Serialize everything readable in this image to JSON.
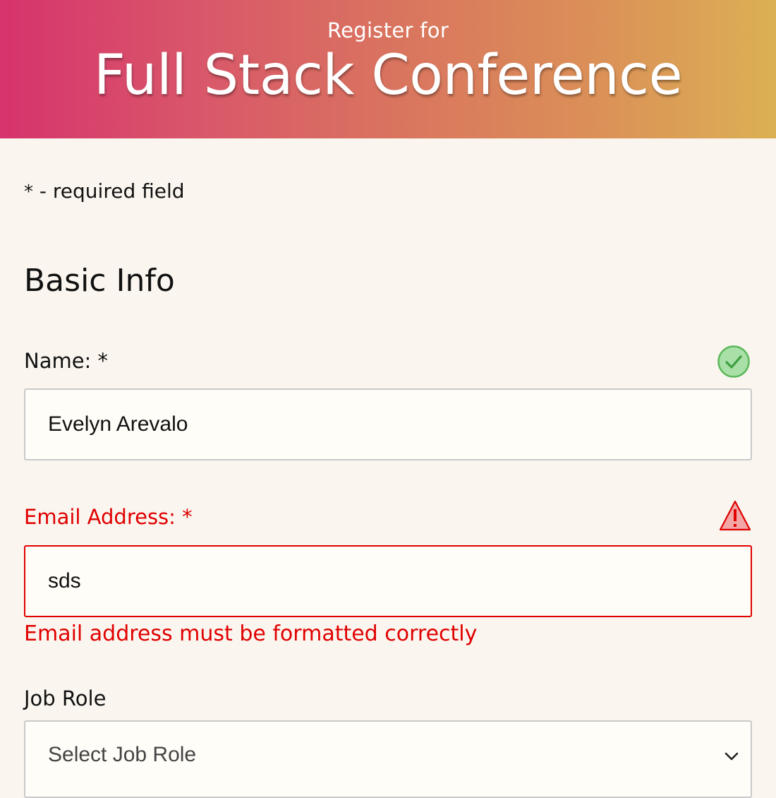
{
  "header": {
    "subtitle": "Register for",
    "title": "Full Stack Conference"
  },
  "required_note": {
    "asterisk": "*",
    "text": " - required field"
  },
  "section": {
    "title": "Basic Info"
  },
  "name_field": {
    "label": "Name: ",
    "required_mark": "*",
    "value": "Evelyn Arevalo",
    "status_icon": "checkmark-circle-icon"
  },
  "email_field": {
    "label": "Email Address: ",
    "required_mark": "*",
    "value": "sds",
    "status_icon": "warning-triangle-icon",
    "error_message": "Email address must be formatted correctly"
  },
  "job_role": {
    "label": "Job Role",
    "selected": "Select Job Role",
    "icon": "chevron-down-icon"
  },
  "colors": {
    "error": "#e00000",
    "success": "#5cb85c",
    "background": "#faf6ef"
  }
}
